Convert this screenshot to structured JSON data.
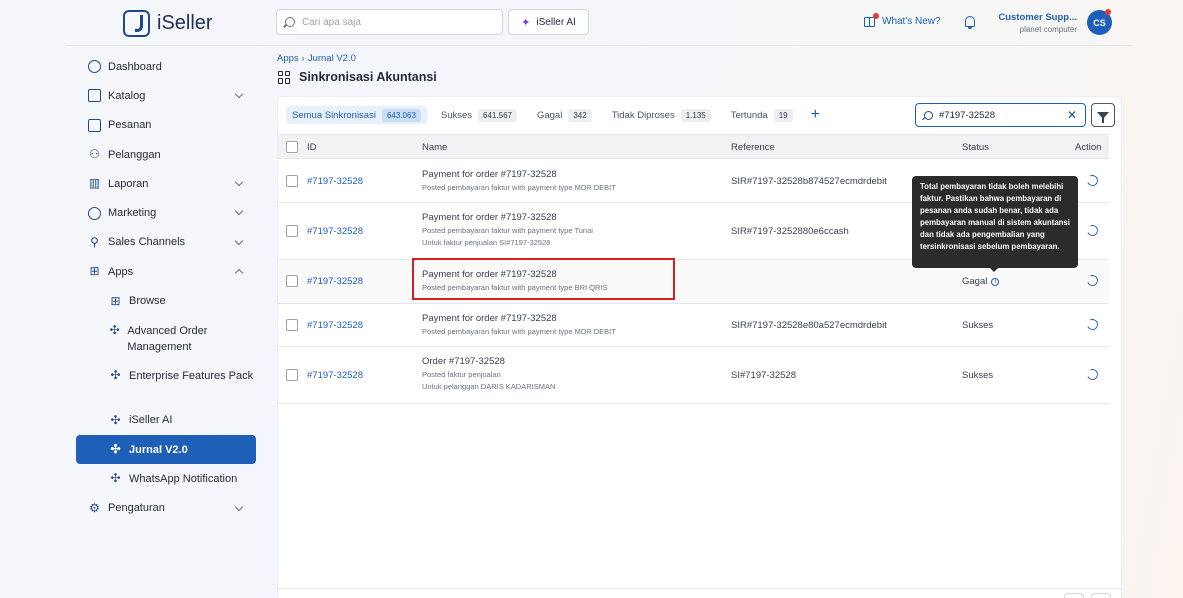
{
  "app": {
    "name": "iSeller"
  },
  "topbar": {
    "search_placeholder": "Cari apa saja",
    "ai_button": "iSeller AI",
    "whats_new": "What's New?",
    "user_name": "Customer Supp...",
    "user_sub": "planet computer",
    "avatar_initials": "CS"
  },
  "sidebar": {
    "items": [
      {
        "label": "Dashboard",
        "icon": "dashboard-icon"
      },
      {
        "label": "Katalog",
        "icon": "catalog-icon"
      },
      {
        "label": "Pesanan",
        "icon": "orders-icon"
      },
      {
        "label": "Pelanggan",
        "icon": "customers-icon"
      },
      {
        "label": "Laporan",
        "icon": "reports-icon"
      },
      {
        "label": "Marketing",
        "icon": "marketing-icon"
      },
      {
        "label": "Sales Channels",
        "icon": "sales-channels-icon"
      },
      {
        "label": "Apps",
        "icon": "apps-icon"
      },
      {
        "label": "Browse",
        "icon": "puzzle-icon"
      },
      {
        "label": "Advanced Order Management",
        "icon": "puzzle-icon"
      },
      {
        "label": "Enterprise Features Pack",
        "icon": "puzzle-icon"
      },
      {
        "label": "iSeller AI",
        "icon": "puzzle-icon"
      },
      {
        "label": "Jurnal V2.0",
        "icon": "puzzle-icon"
      },
      {
        "label": "WhatsApp Notification",
        "icon": "puzzle-icon"
      },
      {
        "label": "Pengaturan",
        "icon": "settings-icon"
      }
    ]
  },
  "breadcrumb": {
    "root": "Apps",
    "current": "Jurnal V2.0"
  },
  "page": {
    "title": "Sinkronisasi Akuntansi"
  },
  "tabs": [
    {
      "label": "Semua Sinkronisasi",
      "count": "643.063"
    },
    {
      "label": "Sukses",
      "count": "641.567"
    },
    {
      "label": "Gagal",
      "count": "342"
    },
    {
      "label": "Tidak Diproses",
      "count": "1.135"
    },
    {
      "label": "Tertunda",
      "count": "19"
    }
  ],
  "filter": {
    "search_value": "#7197-32528"
  },
  "table": {
    "headers": {
      "id": "ID",
      "name": "Name",
      "reference": "Reference",
      "status": "Status",
      "action": "Action"
    },
    "rows": [
      {
        "id": "#7197-32528",
        "name": "Payment for order #7197-32528",
        "desc": "Posted pembayaran faktur with payment type MDR DEBIT",
        "desc2": "",
        "reference": "SIR#7197-32528b874527ecmdrdebit",
        "status": ""
      },
      {
        "id": "#7197-32528",
        "name": "Payment for order #7197-32528",
        "desc": "Posted pembayaran faktur with payment type Tunai",
        "desc2": "Untuk faktur penjualan SI#7197-32528",
        "reference": "SIR#7197-3252880e6ccash",
        "status": ""
      },
      {
        "id": "#7197-32528",
        "name": "Payment for order #7197-32528",
        "desc": "Posted pembayaran faktur with payment type BRI QRIS",
        "desc2": "",
        "reference": "",
        "status": "Gagal"
      },
      {
        "id": "#7197-32528",
        "name": "Payment for order #7197-32528",
        "desc": "Posted pembayaran faktur with payment type MDR DEBIT",
        "desc2": "",
        "reference": "SIR#7197-32528e80a527ecmdrdebit",
        "status": "Sukses"
      },
      {
        "id": "#7197-32528",
        "name": "Order #7197-32528",
        "desc": "Posted faktur penjualan",
        "desc2": "Untuk pelanggan DARIS KADARISMAN",
        "reference": "SI#7197-32528",
        "status": "Sukses"
      }
    ]
  },
  "tooltip": {
    "text": "Total pembayaran tidak boleh melebihi faktur. Pastikan bahwa pembayaran di pesanan anda sudah benar, tidak ada pembayaran manual di sistem akuntansi dan tidak ada pengembalian yang tersinkronisasi sebelum pembayaran."
  },
  "colors": {
    "accent": "#1e5fb8",
    "highlight": "#d91f1f",
    "tooltip_bg": "#2b2b2b"
  }
}
